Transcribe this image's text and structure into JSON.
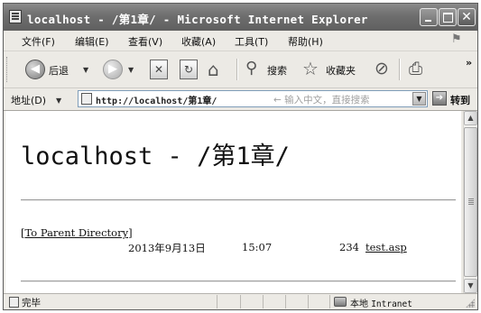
{
  "window": {
    "title": "localhost - /第1章/ - Microsoft Internet Explorer"
  },
  "menu": {
    "items": [
      "文件(F)",
      "编辑(E)",
      "查看(V)",
      "收藏(A)",
      "工具(T)",
      "帮助(H)"
    ]
  },
  "toolbar": {
    "back_label": "后退",
    "search_label": "搜索",
    "favorites_label": "收藏夹",
    "overflow": "»"
  },
  "address": {
    "label": "地址(D)",
    "url": "http://localhost/第1章/",
    "hint": "← 输入中文，直接搜索",
    "go_label": "转到"
  },
  "page": {
    "heading": "localhost - /第1章/",
    "parent_link": "[To Parent Directory]",
    "listing": [
      {
        "date": "2013年9月13日",
        "time": "15:07",
        "size": "234",
        "name": "test.asp"
      }
    ]
  },
  "status": {
    "text": "完毕",
    "zone_prefix": "本地",
    "zone_name": "Intranet"
  }
}
